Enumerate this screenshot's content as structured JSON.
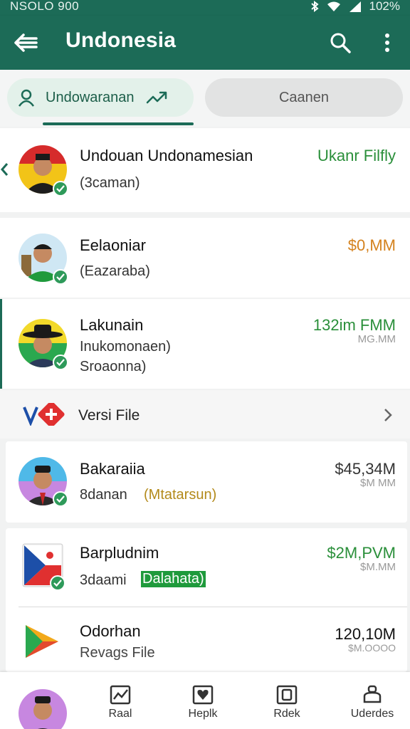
{
  "status_bar": {
    "left_text": "NSOLO 900",
    "battery": "102%"
  },
  "app_bar": {
    "title": "Undonesia"
  },
  "tabs": {
    "active_label": "Undowaranan",
    "inactive_label": "Caanen"
  },
  "items": [
    {
      "name": "Undouan Undonamesian",
      "sub": "(3caman)",
      "amount": "Ukanr Filfly",
      "amount_color": "#2a8f3a"
    },
    {
      "name": "Eelaoniar",
      "sub": "(Eazaraba)",
      "amount": "$0,MM",
      "amount_color": "#d4821e"
    },
    {
      "name": "Lakunain",
      "sub1": "Inukomonaen)",
      "sub2": "Sroaonna)",
      "amount": "132im FMM",
      "amount_sub": "MG.MM",
      "amount_color": "#2a8f3a"
    },
    {
      "name": "Versi File"
    },
    {
      "name": "Bakaraiia",
      "sub": "8danan",
      "sub_tag": "(Mtatarsun)",
      "amount": "$45,34M",
      "amount_sub": "$M MM",
      "amount_color": "#333333",
      "tag_color": "#b38a1a"
    },
    {
      "name": "Barpludnim",
      "sub": "3daami",
      "sub_tag": "Dalahata)",
      "amount": "$2M,PVM",
      "amount_sub": "$M.MM",
      "amount_color": "#2a8f3a",
      "tag_color": "#1f9a3c"
    },
    {
      "name": "Odorhan",
      "sub": "Revags File",
      "amount": "120,10M",
      "amount_sub": "$M.OOOO",
      "amount_color": "#111111"
    }
  ],
  "bottom_nav": [
    {
      "label": "Raal",
      "icon": "chart-icon"
    },
    {
      "label": "Heplk",
      "icon": "heart-icon"
    },
    {
      "label": "Rdek",
      "icon": "document-icon"
    },
    {
      "label": "Uderdes",
      "icon": "bell-icon"
    }
  ],
  "colors": {
    "primary": "#1c6b57",
    "accent_green": "#2a8f3a",
    "accent_orange": "#d4821e"
  }
}
